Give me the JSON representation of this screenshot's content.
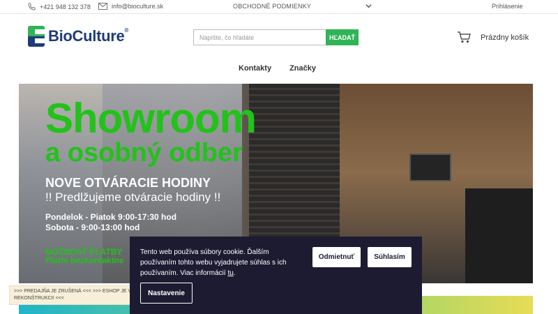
{
  "topbar": {
    "phone": "+421 948 132 378",
    "email": "info@bioculture.sk",
    "terms": "OBCHODNÉ PODMIENKY",
    "login": "Prihlásenie"
  },
  "logo": {
    "name": "BioCulture",
    "reg": "®"
  },
  "search": {
    "placeholder": "Napíšte, čo hľadáte",
    "button": "HĽADAŤ"
  },
  "cart": {
    "label": "Prázdny košík"
  },
  "nav": [
    "Kontakty",
    "Značky"
  ],
  "hero": {
    "heading": "Showroom",
    "subheading": "a osobný odber",
    "line1": "NOVE OTVÁRACIE HODINY",
    "line2": "!! Predlžujeme otváracie hodiny !!",
    "hours1": "Pondelok - Piatok 9:00-17:30 hod",
    "hours2": "Sobota - 9:00-13:00 hod",
    "pay1": "MOŽNOSŤ PLATBY",
    "pay2": "Platte bezkontaktne"
  },
  "ticker": ">>> PREDAJŇA JE ZRUŠENÁ <<< >>> ESHOP JE V REKONŠTRUKCII <<<",
  "cookie": {
    "text_before": "Tento web používa súbory cookie. Ďalším používaním tohto webu vyjadrujete súhlas s ich používaním. Viac informácií ",
    "link": "tu",
    "text_after": ".",
    "reject": "Odmietnuť",
    "accept": "Súhlasím",
    "settings": "Nastavenie"
  },
  "colors": {
    "brand_green": "#2fb457",
    "hero_green": "#22c21a",
    "logo_blue": "#1f3c7a",
    "cookie_bg": "#1d1b31"
  }
}
